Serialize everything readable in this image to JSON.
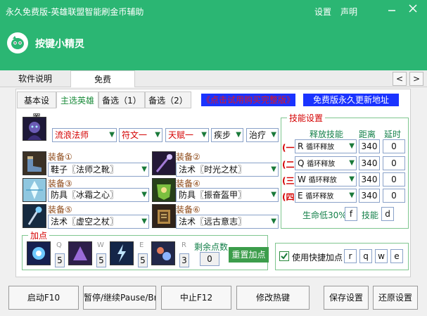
{
  "window": {
    "title": "永久免费版-英雄联盟智能刷金币辅助",
    "settings": "设置",
    "statement": "声明",
    "minimize_icon": "minus-icon",
    "close_icon": "close-icon"
  },
  "brand": {
    "logo_icon": "assistant-logo-icon",
    "name": "按键小精灵"
  },
  "top_tabs": [
    {
      "label": "软件说明"
    },
    {
      "label": "免费"
    }
  ],
  "nav_arrows": {
    "prev": "<",
    "next": ">"
  },
  "sub_tabs": [
    {
      "label": "基本设置"
    },
    {
      "label": "主选英雄"
    },
    {
      "label": "备选（1）"
    },
    {
      "label": "备选（2）"
    }
  ],
  "promos": {
    "buy_full": "《点击试用购买完整版》",
    "update_address": "免费版永久更新地址"
  },
  "hero": {
    "portrait_icon": "hero-portrait-icon",
    "name": "流浪法师",
    "rune": "符文一",
    "talent": "天赋一",
    "summoner1": "疾步",
    "summoner2": "治疗"
  },
  "equipment": [
    {
      "label": "装备①",
      "value": "鞋子〖法师之靴〗",
      "icon": "boots-icon"
    },
    {
      "label": "装备②",
      "value": "法术〖时光之杖〗",
      "icon": "staff-icon"
    },
    {
      "label": "装备③",
      "value": "防具〖冰霜之心〗",
      "icon": "ice-armor-icon"
    },
    {
      "label": "装备④",
      "value": "防具〖振奋盔甲〗",
      "icon": "spirit-armor-icon"
    },
    {
      "label": "装备⑤",
      "value": "法术〖虚空之杖〗",
      "icon": "void-staff-icon"
    },
    {
      "label": "装备⑥",
      "value": "法术〖远古意志〗",
      "icon": "ancient-will-icon"
    }
  ],
  "skills": {
    "group_label": "技能设置",
    "col_release": "释放技能",
    "col_distance": "距离",
    "col_delay": "延时",
    "rows": [
      {
        "mark": "(一)",
        "key": "R",
        "mode": "循环释放",
        "distance": "340",
        "delay": "0"
      },
      {
        "mark": "(二)",
        "key": "Q",
        "mode": "循环释放",
        "distance": "340",
        "delay": "0"
      },
      {
        "mark": "(三)",
        "key": "W",
        "mode": "循环释放",
        "distance": "340",
        "delay": "0"
      },
      {
        "mark": "(四)",
        "key": "E",
        "mode": "循环释放",
        "distance": "340",
        "delay": "0"
      }
    ],
    "low_hp_label": "生命低30%",
    "low_hp_key": "f",
    "skill_label": "技能",
    "skill_key": "d"
  },
  "points": {
    "group_label": "加点",
    "skills": [
      {
        "key": "Q",
        "value": "5",
        "icon": "q-skill-icon"
      },
      {
        "key": "W",
        "value": "5",
        "icon": "w-skill-icon"
      },
      {
        "key": "E",
        "value": "5",
        "icon": "e-skill-icon"
      },
      {
        "key": "R",
        "value": "3",
        "icon": "r-skill-icon"
      }
    ],
    "remaining_label": "剩余点数",
    "remaining_value": "0",
    "reset": "重置加点",
    "hotkey_checkbox_label": "使用快捷加点",
    "hotkey_checked": true,
    "hotkeys": [
      "r",
      "q",
      "w",
      "e"
    ]
  },
  "bottom_buttons": {
    "start": "启动F10",
    "pause": "暂停/继续Pause/Break",
    "stop": "中止F12",
    "hotkeys": "修改热键",
    "save": "保存设置",
    "restore": "还原设置"
  },
  "colors": {
    "titlebar": "#2bb673",
    "accent_green": "#3c9d4b",
    "promo_red": "#e0191b",
    "promo_blue": "#1a33ff"
  }
}
